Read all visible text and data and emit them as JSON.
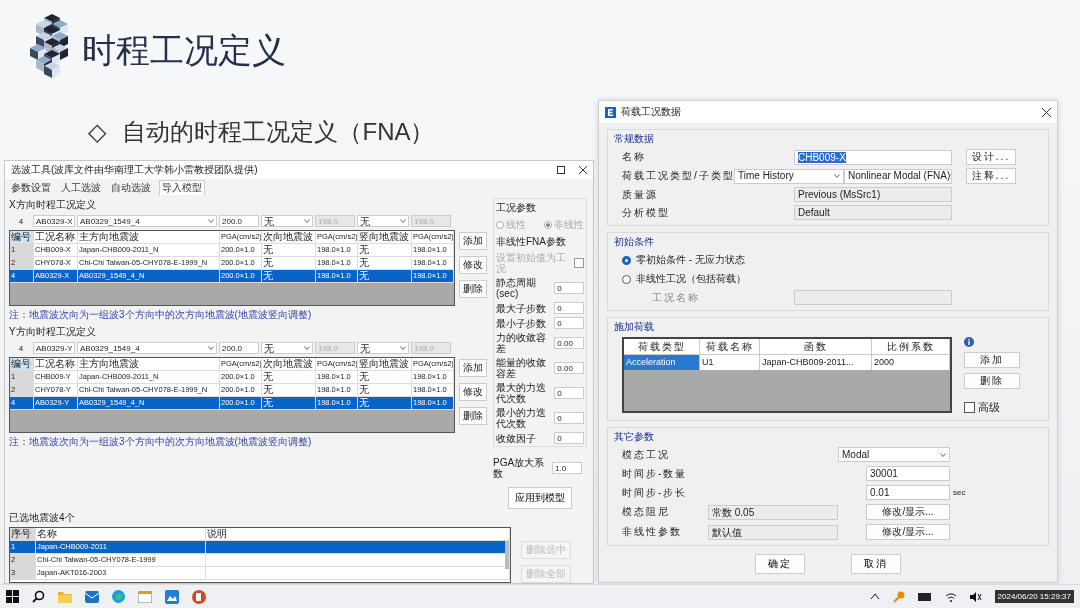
{
  "slide": {
    "title": "时程工况定义",
    "bullet_marker": "◇",
    "bullet": "自动的时程工况定义（FNA）"
  },
  "wave_tool": {
    "title": "选波工具(波库文件由华南理工大学韩小雷教授团队提供)",
    "tabs": [
      {
        "label": "参数设置",
        "selected": false
      },
      {
        "label": "人工选波",
        "selected": false
      },
      {
        "label": "自动选波",
        "selected": false
      },
      {
        "label": "导入模型",
        "selected": true
      }
    ],
    "groups": [
      {
        "heading": "X方向时程工况定义",
        "inputs": [
          {
            "kind": "label",
            "value": "4",
            "disabled": false
          },
          {
            "kind": "field",
            "value": "AB0329-X",
            "disabled": false
          },
          {
            "kind": "dropdown",
            "value": "AB0329_1549_4",
            "disabled": false
          },
          {
            "kind": "field",
            "value": "200.0",
            "disabled": false
          },
          {
            "kind": "dropdown",
            "value": "无",
            "disabled": false
          },
          {
            "kind": "field",
            "value": "198.0",
            "disabled": true
          },
          {
            "kind": "dropdown",
            "value": "无",
            "disabled": false
          },
          {
            "kind": "field",
            "value": "198.0",
            "disabled": true
          }
        ],
        "columns": [
          "编号",
          "工况名称",
          "主方向地震波",
          "PGA(cm/s2)",
          "次向地震波",
          "PGA(cm/s2)",
          "竖向地震波",
          "PGA(cm/s2)"
        ],
        "rows": [
          {
            "cells": [
              "1",
              "CHB009-X",
              "Japan-CHB009-2011_N",
              "200.0×1.0",
              "无",
              "198.0×1.0",
              "无",
              "198.0×1.0"
            ],
            "selected": false
          },
          {
            "cells": [
              "2",
              "CHY078-X",
              "Chi-Chi Taiwan-05-CHY078-E-1999_N",
              "200.0×1.0",
              "无",
              "198.0×1.0",
              "无",
              "198.0×1.0"
            ],
            "selected": false
          },
          {
            "cells": [
              "4",
              "AB0329-X",
              "AB0329_1549_4_N",
              "200.0×1.0",
              "无",
              "198.0×1.0",
              "无",
              "198.0×1.0"
            ],
            "selected": true
          }
        ],
        "buttons": [
          "添加",
          "修改",
          "删除"
        ],
        "note": "注：地震波次向为一组波3个方向中的次方向地震波(地震波竖向调整)"
      },
      {
        "heading": "Y方向时程工况定义",
        "inputs": [
          {
            "kind": "label",
            "value": "4",
            "disabled": false
          },
          {
            "kind": "field",
            "value": "AB0329-Y",
            "disabled": false
          },
          {
            "kind": "dropdown",
            "value": "AB0329_1549_4",
            "disabled": false
          },
          {
            "kind": "field",
            "value": "200.0",
            "disabled": false
          },
          {
            "kind": "dropdown",
            "value": "无",
            "disabled": false
          },
          {
            "kind": "field",
            "value": "198.0",
            "disabled": true
          },
          {
            "kind": "dropdown",
            "value": "无",
            "disabled": false
          },
          {
            "kind": "field",
            "value": "198.0",
            "disabled": true
          }
        ],
        "columns": [
          "编号",
          "工况名称",
          "主方向地震波",
          "PGA(cm/s2)",
          "次向地震波",
          "PGA(cm/s2)",
          "竖向地震波",
          "PGA(cm/s2)"
        ],
        "rows": [
          {
            "cells": [
              "1",
              "CHB009-Y",
              "Japan-CHB009-2011_N",
              "200.0×1.0",
              "无",
              "198.0×1.0",
              "无",
              "198.0×1.0"
            ],
            "selected": false
          },
          {
            "cells": [
              "2",
              "CHY078-Y",
              "Chi-Chi Taiwan-05-CHY078-E-1999_N",
              "200.0×1.0",
              "无",
              "198.0×1.0",
              "无",
              "198.0×1.0"
            ],
            "selected": false
          },
          {
            "cells": [
              "4",
              "AB0329-Y",
              "AB0329_1549_4_N",
              "200.0×1.0",
              "无",
              "198.0×1.0",
              "无",
              "198.0×1.0"
            ],
            "selected": true
          }
        ],
        "buttons": [
          "添加",
          "修改",
          "删除"
        ],
        "note": "注：地震波次向为一组波3个方向中的次方向地震波(地震波竖向调整)"
      }
    ],
    "params": {
      "items": [
        {
          "kind": "heading",
          "label": "工况参数"
        },
        {
          "kind": "radios",
          "options": [
            {
              "label": "线性",
              "selected": false,
              "disabled": true
            },
            {
              "label": "非线性",
              "selected": true,
              "disabled": true
            }
          ]
        },
        {
          "kind": "heading",
          "label": "非线性FNA参数"
        },
        {
          "kind": "checkbox",
          "label": "设置初始值为工况",
          "checked": false,
          "disabled": true
        },
        {
          "kind": "field",
          "label": "静态周期(sec)",
          "value": "0"
        },
        {
          "kind": "field",
          "label": "最大子步数",
          "value": "0"
        },
        {
          "kind": "field",
          "label": "最小子步数",
          "value": "0"
        },
        {
          "kind": "field",
          "label": "力的收敛容差",
          "value": "0.00"
        },
        {
          "kind": "field",
          "label": "能量的收敛容差",
          "value": "0.00"
        },
        {
          "kind": "field",
          "label": "最大的力迭代次数",
          "value": "0"
        },
        {
          "kind": "field",
          "label": "最小的力迭代次数",
          "value": "0"
        },
        {
          "kind": "field",
          "label": "收敛因子",
          "value": "0"
        }
      ],
      "pga_factor": {
        "label": "PGA放大系数",
        "value": "1.0"
      },
      "apply_button": "应用到模型"
    },
    "selected_waves": {
      "heading": "已选地震波4个",
      "columns": [
        "序号",
        "名称",
        "说明"
      ],
      "rows": [
        {
          "number": "1",
          "name": "Japan-CHB009-2011",
          "selected": true
        },
        {
          "number": "2",
          "name": "Chi-Chi Taiwan-05-CHY078-E-1999",
          "selected": false
        },
        {
          "number": "3",
          "name": "Japan-AKT016-2003",
          "selected": false
        }
      ],
      "buttons": [
        {
          "label": "删除选中",
          "disabled": true
        },
        {
          "label": "删除全部",
          "disabled": true
        }
      ]
    }
  },
  "load_case": {
    "title": "荷载工况数据",
    "general": {
      "heading": "常规数据",
      "name_label": "名称",
      "name_value": "CHB009-X",
      "name_selected": true,
      "design_button": "设计...",
      "type_label": "荷载工况类型/子类型",
      "type": "Time History",
      "subtype": "Nonlinear Modal (FNA)",
      "notes_button": "注释...",
      "mass_label": "质量源",
      "mass": "Previous (MsSrc1)",
      "model_label": "分析模型",
      "model": "Default"
    },
    "initial": {
      "heading": "初始条件",
      "options": [
        {
          "label": "零初始条件 - 无应力状态",
          "selected": true
        },
        {
          "label": "非线性工况（包括荷载）",
          "selected": false
        }
      ],
      "case_label": "工况名称"
    },
    "loads": {
      "heading": "施加荷载",
      "columns": [
        "荷载类型",
        "荷载名称",
        "函数",
        "比例系数"
      ],
      "rows": [
        {
          "cells": [
            "Acceleration",
            "U1",
            "Japan-CHB009-2011...",
            "2000"
          ],
          "selected": true
        }
      ],
      "buttons": [
        "添加",
        "删除"
      ],
      "advanced": {
        "label": "高级",
        "checked": false
      }
    },
    "other": {
      "heading": "其它参数",
      "modal_label": "模态工况",
      "modal": "Modal",
      "steps_label": "时间步-数量",
      "steps": "30001",
      "step_size_label": "时间步-步长",
      "step_size": "0.01",
      "unit": "sec",
      "damping_label": "模态阻尼",
      "damping": "常数 0.05",
      "damping_button": "修改/显示...",
      "nonlinear_label": "非线性参数",
      "nonlinear": "默认值",
      "nonlinear_button": "修改/显示..."
    },
    "footer_buttons": [
      "确定",
      "取消"
    ]
  },
  "taskbar": {
    "clock": "2024/06/20 15:29:37"
  }
}
